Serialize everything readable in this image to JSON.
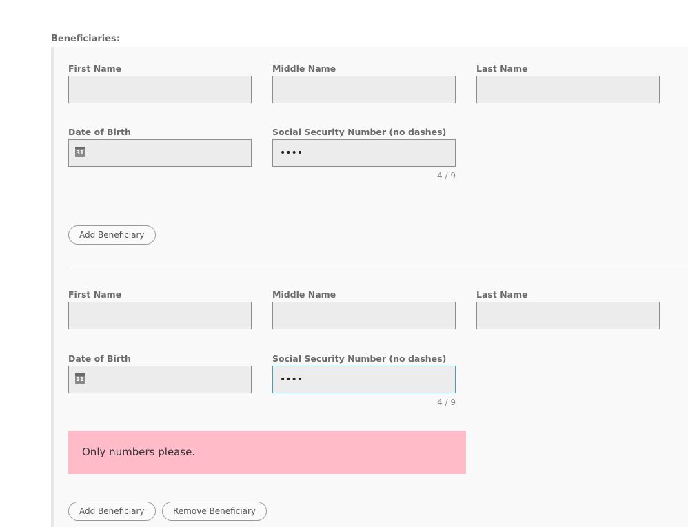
{
  "section": {
    "title": "Beneficiaries:"
  },
  "beneficiaries": [
    {
      "first_name": {
        "label": "First Name",
        "value": ""
      },
      "middle_name": {
        "label": "Middle Name",
        "value": ""
      },
      "last_name": {
        "label": "Last Name",
        "value": ""
      },
      "dob": {
        "label": "Date of Birth",
        "value": "",
        "icon": "calendar-icon",
        "icon_text": "31"
      },
      "ssn": {
        "label": "Social Security Number (no dashes)",
        "value": "••••",
        "counter": "4 / 9"
      },
      "add_button": "Add Beneficiary"
    },
    {
      "first_name": {
        "label": "First Name",
        "value": ""
      },
      "middle_name": {
        "label": "Middle Name",
        "value": ""
      },
      "last_name": {
        "label": "Last Name",
        "value": ""
      },
      "dob": {
        "label": "Date of Birth",
        "value": "",
        "icon": "calendar-icon",
        "icon_text": "31"
      },
      "ssn": {
        "label": "Social Security Number (no dashes)",
        "value": "••••",
        "counter": "4 / 9"
      },
      "error": "Only numbers please.",
      "add_button": "Add Beneficiary",
      "remove_button": "Remove Beneficiary"
    }
  ],
  "colors": {
    "error_bg": "#ffbcc8",
    "focus_border": "#3aa0c8",
    "panel_bg": "#f9f9f9"
  }
}
